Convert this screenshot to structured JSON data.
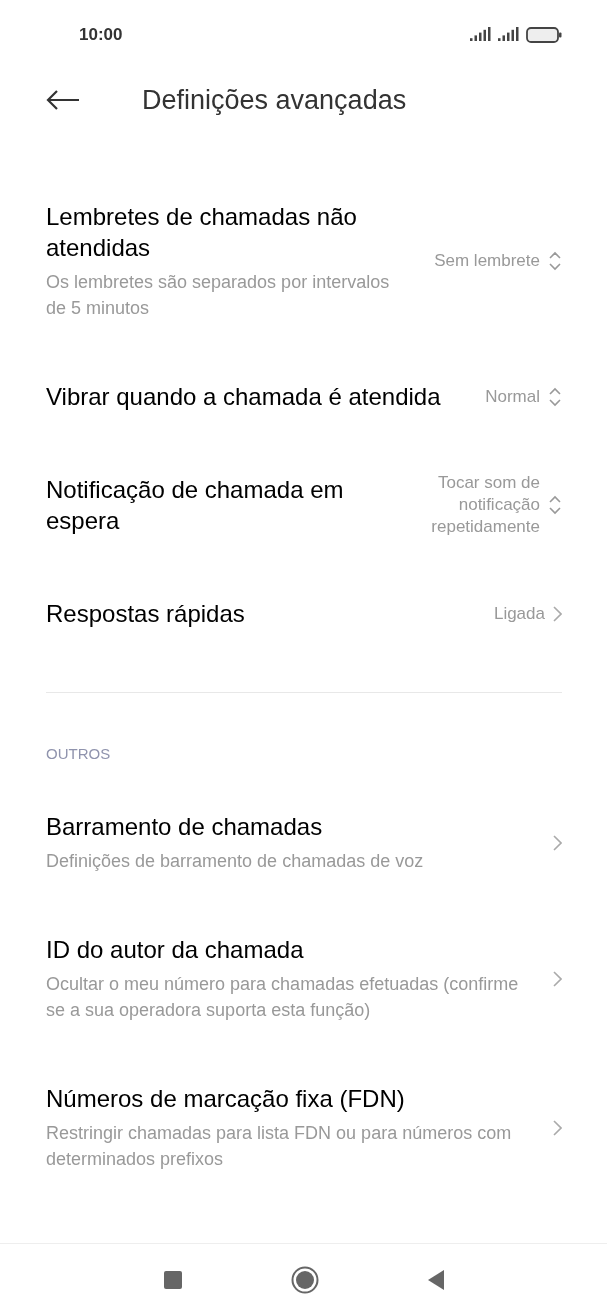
{
  "status_bar": {
    "time": "10:00"
  },
  "header": {
    "title": "Definições avançadas"
  },
  "items": [
    {
      "kind": "select",
      "title": "Lembretes de chamadas não atendidas",
      "subtitle": "Os lembretes são separados por intervalos de 5 minutos",
      "value": "Sem lembrete"
    },
    {
      "kind": "select",
      "title": "Vibrar quando a chamada é atendida",
      "value": "Normal"
    },
    {
      "kind": "select",
      "title": "Notificação de chamada em espera",
      "value": "Tocar som de notificação repetidamente"
    },
    {
      "kind": "link",
      "title": "Respostas rápidas",
      "value": "Ligada"
    }
  ],
  "section": {
    "label": "OUTROS",
    "items": [
      {
        "kind": "link",
        "title": "Barramento de chamadas",
        "subtitle": "Definições de barramento de chamadas de voz"
      },
      {
        "kind": "link",
        "title": "ID do autor da chamada",
        "subtitle": "Ocultar o meu número para chamadas efetuadas (confirme se a sua operadora suporta esta função)"
      },
      {
        "kind": "link",
        "title": "Números de marcação fixa (FDN)",
        "subtitle": "Restringir chamadas para lista FDN ou para números com determinados prefixos"
      }
    ]
  }
}
